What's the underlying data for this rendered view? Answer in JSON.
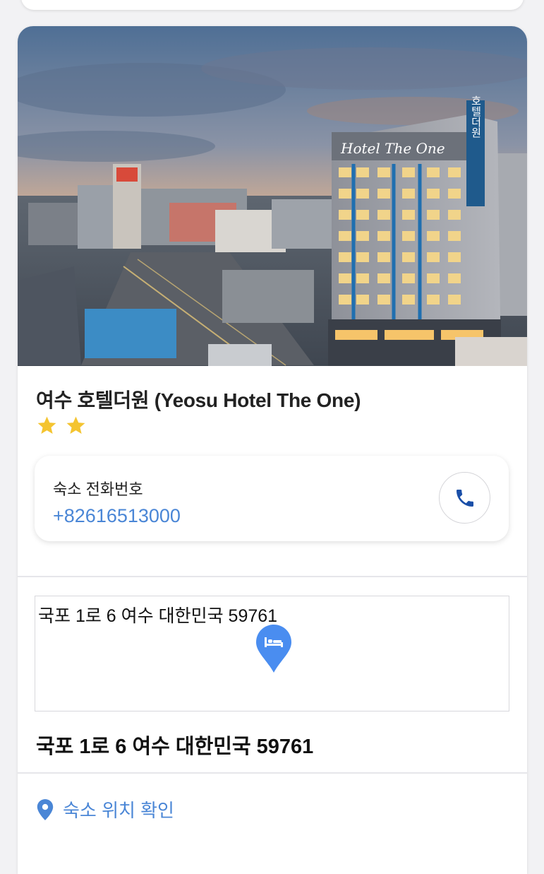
{
  "hotel": {
    "title": "여수 호텔더원 (Yeosu Hotel The One)",
    "star_rating": 2,
    "star_color": "#f4c430",
    "sign_text": "Hotel The One",
    "vertical_sign_text": "호텔더원"
  },
  "phone": {
    "label": "숙소 전화번호",
    "number": "+82616513000",
    "call_icon": "phone-icon"
  },
  "map": {
    "caption": "국포 1로 6 여수 대한민국 59761",
    "pin_icon": "bed-icon"
  },
  "address": "국포 1로 6 여수 대한민국 59761",
  "location_link": {
    "label": "숙소 위치 확인",
    "icon": "location-pin-icon"
  },
  "colors": {
    "accent": "#4a86d6",
    "pin": "#4a8df0"
  }
}
